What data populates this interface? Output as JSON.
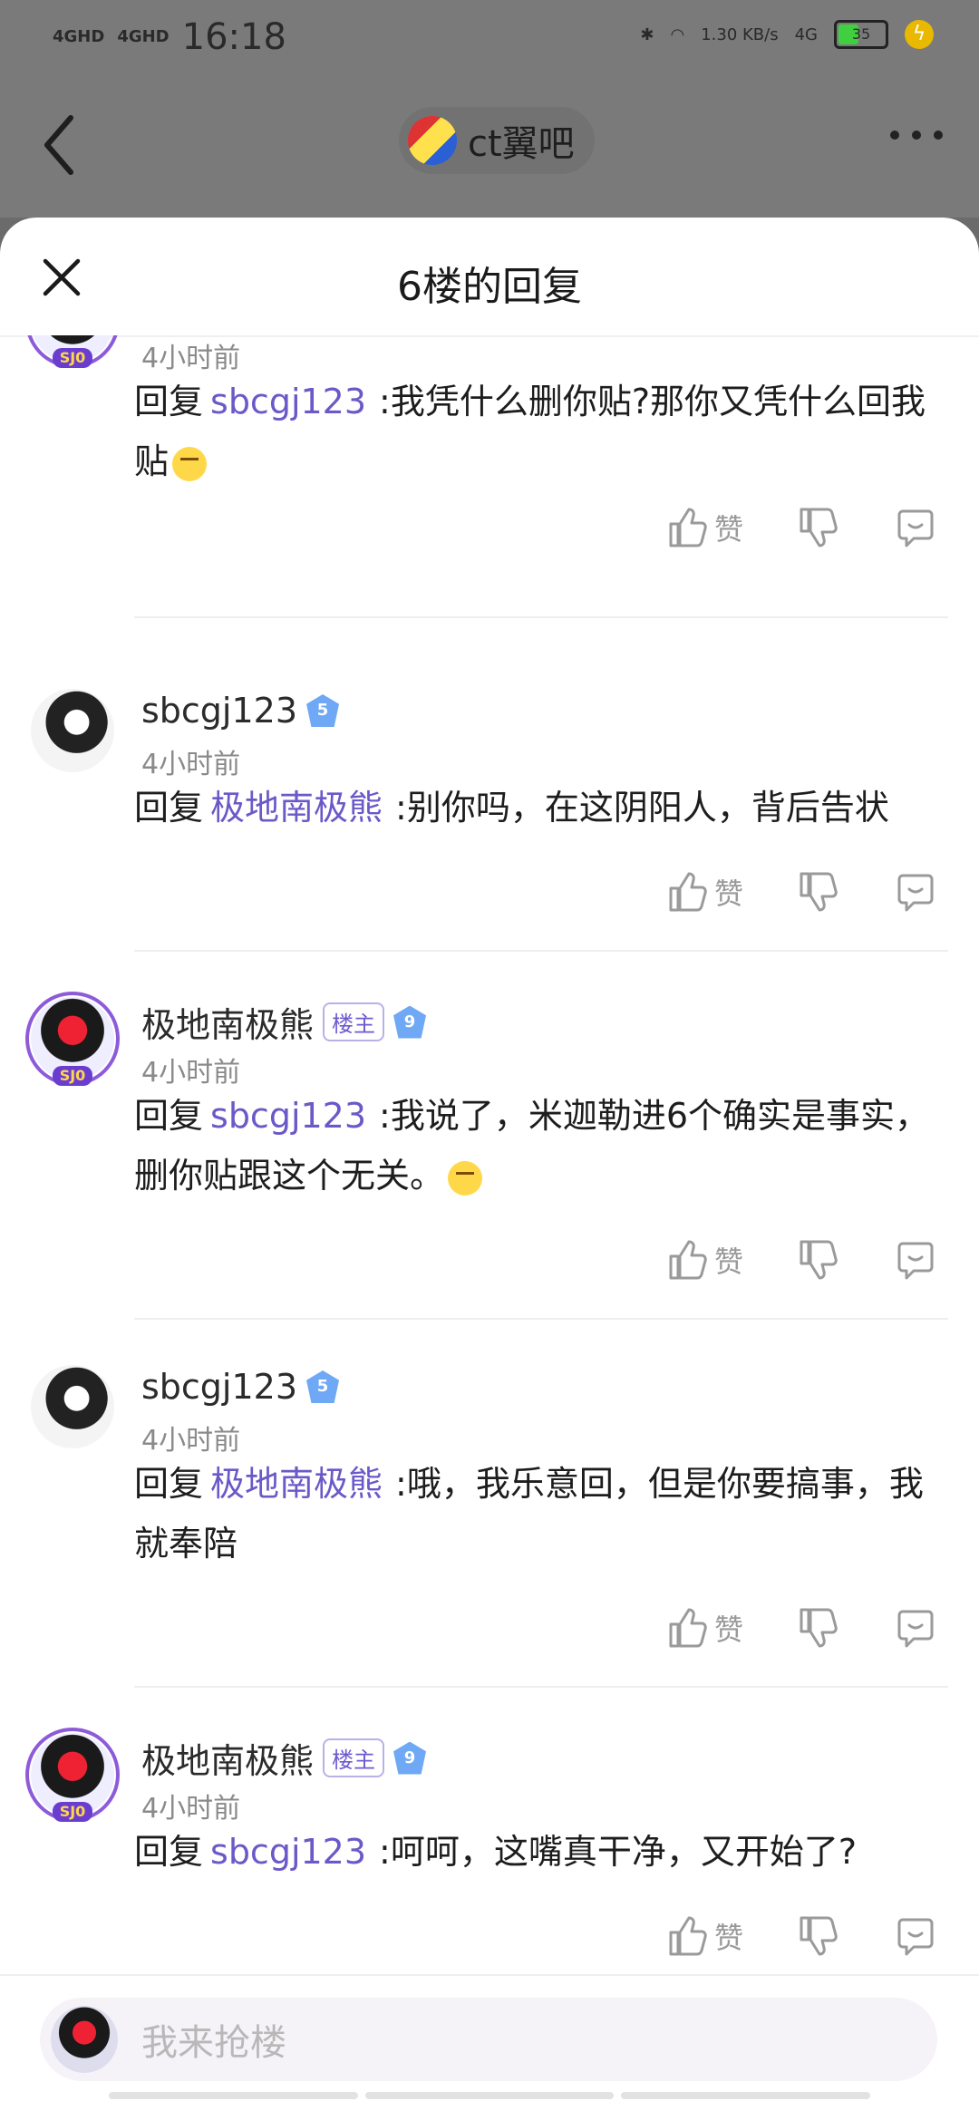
{
  "status_bar": {
    "network_1": "4GHD",
    "network_2": "4GHD",
    "time": "16:18",
    "speed": "1.30 KB/s",
    "mobile": "4G",
    "battery": "35"
  },
  "nav": {
    "forum_name": "ct翼吧"
  },
  "sheet": {
    "title": "6楼的回复"
  },
  "replies": [
    {
      "username": "",
      "time": "4小时前",
      "prefix": "回复",
      "mention": "sbcgj123",
      "text": ":我凭什么删你贴?那你又凭什么回我贴",
      "like_label": "赞"
    },
    {
      "username": "sbcgj123",
      "level": "5",
      "time": "4小时前",
      "prefix": "回复",
      "mention": "极地南极熊",
      "text": ":别你吗，在这阴阳人，背后告状",
      "like_label": "赞"
    },
    {
      "username": "极地南极熊",
      "badge": "楼主",
      "level": "9",
      "time": "4小时前",
      "prefix": "回复",
      "mention": "sbcgj123",
      "text": ":我说了，米迦勒进6个确实是事实，删你贴跟这个无关。",
      "like_label": "赞"
    },
    {
      "username": "sbcgj123",
      "level": "5",
      "time": "4小时前",
      "prefix": "回复",
      "mention": "极地南极熊",
      "text": ":哦，我乐意回，但是你要搞事，我就奉陪",
      "like_label": "赞"
    },
    {
      "username": "极地南极熊",
      "badge": "楼主",
      "level": "9",
      "time": "4小时前",
      "prefix": "回复",
      "mention": "sbcgj123",
      "text": ":呵呵，这嘴真干净，又开始了?",
      "like_label": "赞"
    }
  ],
  "avatar_frame_tag": "SJ0",
  "input": {
    "placeholder": "我来抢楼"
  },
  "colors": {
    "mention": "#6b59c8",
    "level_badge": "#6fa8f5"
  }
}
